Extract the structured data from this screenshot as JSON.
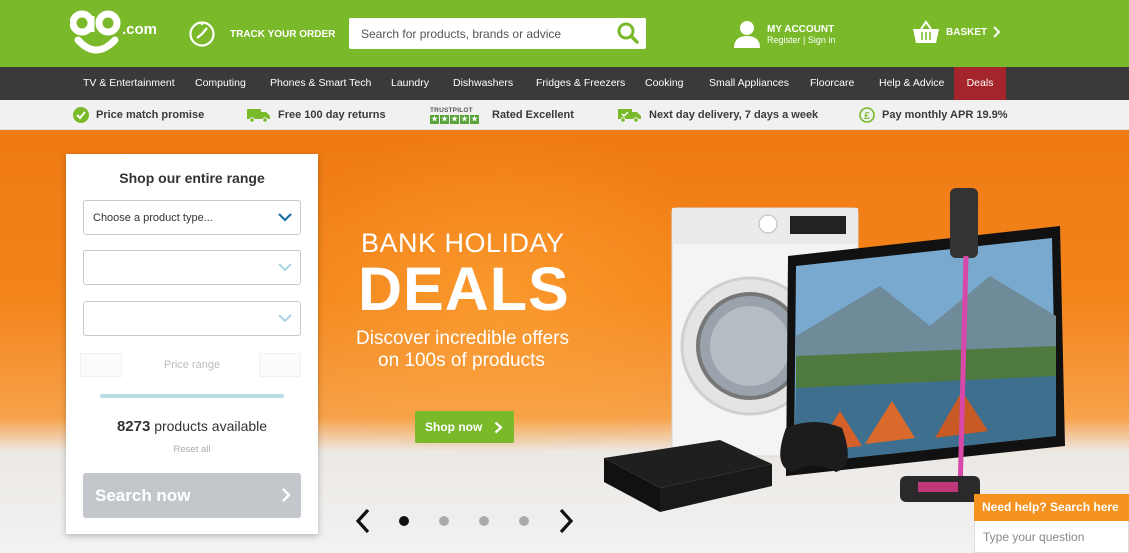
{
  "header": {
    "logo_text": "ao.com",
    "track_label": "TRACK YOUR ORDER",
    "search_placeholder": "Search for products, brands or advice",
    "account_title": "MY ACCOUNT",
    "account_register": "Register",
    "account_sep": "|",
    "account_signin": "Sign in",
    "basket_label": "BASKET"
  },
  "nav": {
    "items": [
      "TV & Entertainment",
      "Computing",
      "Phones & Smart Tech",
      "Laundry",
      "Dishwashers",
      "Fridges & Freezers",
      "Cooking",
      "Small Appliances",
      "Floorcare",
      "Help & Advice",
      "Deals"
    ]
  },
  "usp": {
    "price_match": "Price match promise",
    "returns": "Free 100 day returns",
    "trustpilot_label": "TRUSTPILOT",
    "rated": "Rated Excellent",
    "delivery": "Next day delivery, 7 days a week",
    "monthly": "Pay monthly APR 19.9%"
  },
  "hero": {
    "title_line1": "BANK HOLIDAY",
    "title_line2": "DEALS",
    "sub_line1": "Discover incredible offers",
    "sub_line2": "on 100s of products",
    "cta": "Shop now",
    "slides": 4,
    "active_slide": 1
  },
  "panel": {
    "title": "Shop our entire range",
    "select1": "Choose a product type...",
    "select2": "",
    "select3": "",
    "price_label": "Price range",
    "products_count": "8273",
    "products_text": " products available",
    "reset": "Reset all",
    "search_button": "Search now"
  },
  "help": {
    "header": "Need help? Search here",
    "placeholder": "Type your question"
  },
  "colors": {
    "brand_green": "#7ab929",
    "nav_dark": "#3a3a3a",
    "deals_red": "#a4262c",
    "hero_orange": "#f07a13",
    "help_orange": "#f6921e"
  }
}
